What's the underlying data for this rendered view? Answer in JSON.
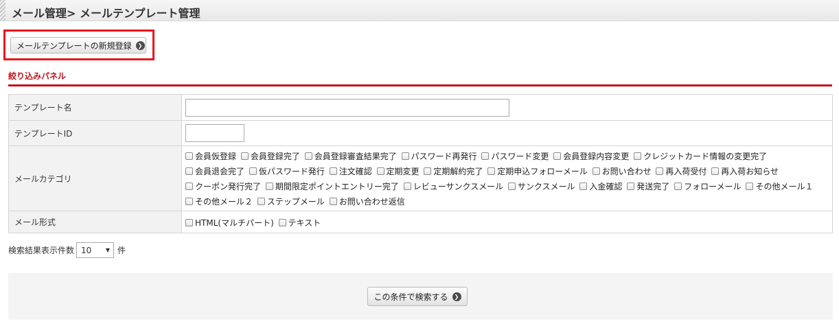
{
  "header": {
    "title": "メール管理> メールテンプレート管理"
  },
  "new_button": {
    "label": "メールテンプレートの新規登録",
    "icon": "arrow-circle-right-icon"
  },
  "panel": {
    "title": "絞り込みパネル"
  },
  "filters": {
    "template_name": {
      "label": "テンプレート名",
      "value": ""
    },
    "template_id": {
      "label": "テンプレートID",
      "value": ""
    },
    "mail_category": {
      "label": "メールカテゴリ",
      "options": [
        "会員仮登録",
        "会員登録完了",
        "会員登録審査結果完了",
        "パスワード再発行",
        "パスワード変更",
        "会員登録内容変更",
        "クレジットカード情報の変更完了",
        "会員退会完了",
        "仮パスワード発行",
        "注文確認",
        "定期変更",
        "定期解約完了",
        "定期申込フォローメール",
        "お問い合わせ",
        "再入荷受付",
        "再入荷お知らせ",
        "クーポン発行完了",
        "期間限定ポイントエントリー完了",
        "レビューサンクスメール",
        "サンクスメール",
        "入金確認",
        "発送完了",
        "フォローメール",
        "その他メール１",
        "その他メール２",
        "ステップメール",
        "お問い合わせ返信"
      ]
    },
    "mail_format": {
      "label": "メール形式",
      "options": [
        "HTML(マルチパート)",
        "テキスト"
      ]
    }
  },
  "result_count": {
    "label": "検索結果表示件数",
    "selected": "10",
    "suffix": "件"
  },
  "search_button": {
    "label": "この条件で検索する",
    "icon": "arrow-circle-right-icon"
  },
  "colors": {
    "accent": "#c4121c",
    "highlight_border": "#e8141c"
  }
}
